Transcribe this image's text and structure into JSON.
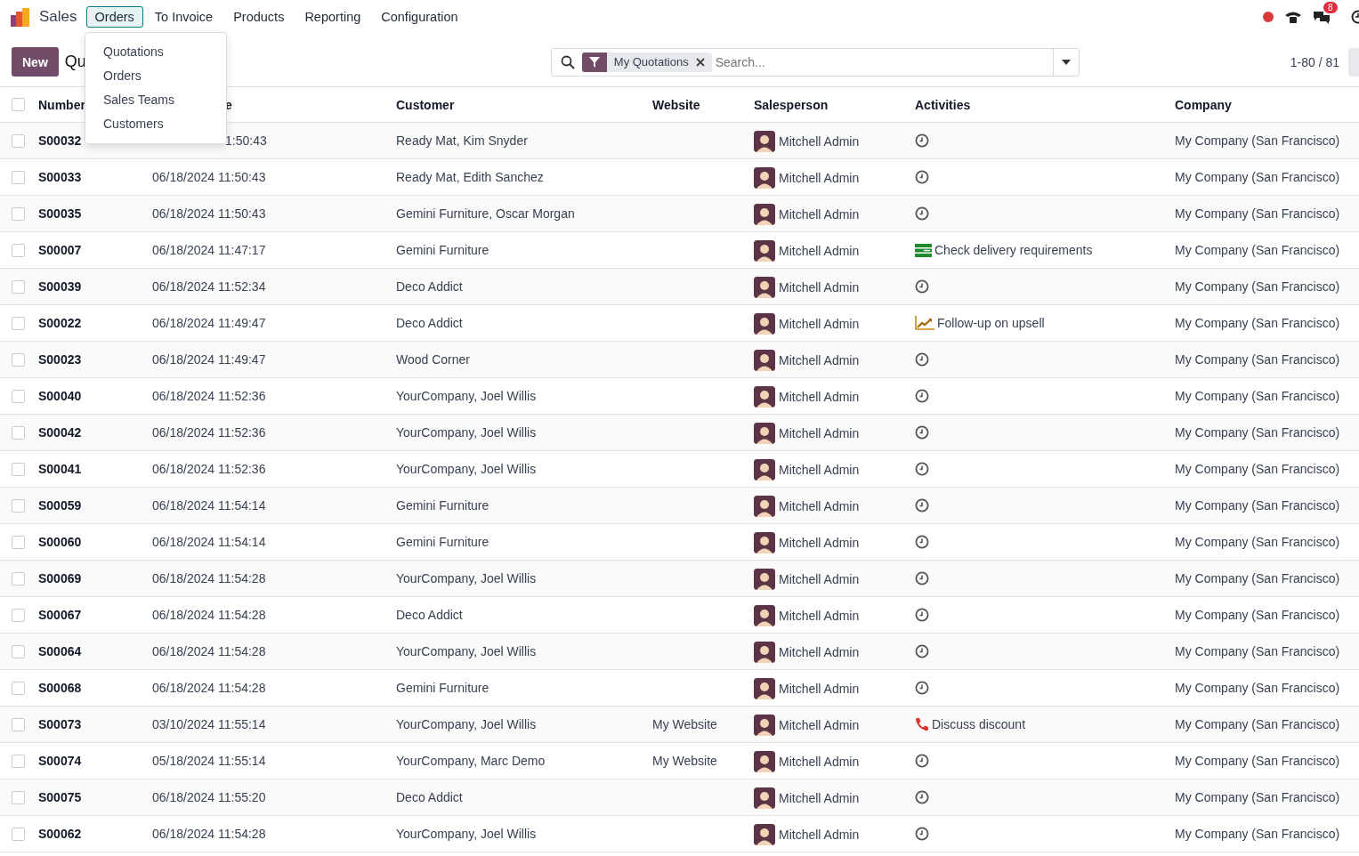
{
  "app": {
    "name": "Sales"
  },
  "menu": [
    {
      "label": "Orders",
      "selected": true
    },
    {
      "label": "To Invoice",
      "selected": false
    },
    {
      "label": "Products",
      "selected": false
    },
    {
      "label": "Reporting",
      "selected": false
    },
    {
      "label": "Configuration",
      "selected": false
    }
  ],
  "systray": {
    "messages_badge": "8"
  },
  "dropdown": {
    "open": true,
    "items": [
      "Quotations",
      "Orders",
      "Sales Teams",
      "Customers"
    ]
  },
  "control_panel": {
    "new_button": "New",
    "title": "Qu",
    "facet": "My Quotations",
    "placeholder": "Search...",
    "pager": "1-80 / 81"
  },
  "table": {
    "select_all_checked": false,
    "columns": [
      "Number",
      "e",
      "Customer",
      "Website",
      "Salesperson",
      "Activities",
      "Company"
    ],
    "rows": [
      {
        "checked": false,
        "number": "S00032",
        "date": "1:50:43",
        "customer": "Ready Mat, Kim Snyder",
        "salesperson": "Mitchell Admin",
        "activity": {
          "kind": "none"
        },
        "company": "My Company (San Francisco)"
      },
      {
        "checked": false,
        "number": "S00033",
        "date": "06/18/2024 11:50:43",
        "customer": "Ready Mat, Edith Sanchez",
        "salesperson": "Mitchell Admin",
        "activity": {
          "kind": "none"
        },
        "company": "My Company (San Francisco)"
      },
      {
        "checked": false,
        "number": "S00035",
        "date": "06/18/2024 11:50:43",
        "customer": "Gemini Furniture, Oscar Morgan",
        "salesperson": "Mitchell Admin",
        "activity": {
          "kind": "none"
        },
        "company": "My Company (San Francisco)"
      },
      {
        "checked": false,
        "number": "S00007",
        "date": "06/18/2024 11:47:17",
        "customer": "Gemini Furniture",
        "salesperson": "Mitchell Admin",
        "activity": {
          "kind": "todo",
          "text": "Check delivery requirements"
        },
        "company": "My Company (San Francisco)"
      },
      {
        "checked": false,
        "number": "S00039",
        "date": "06/18/2024 11:52:34",
        "customer": "Deco Addict",
        "salesperson": "Mitchell Admin",
        "activity": {
          "kind": "none"
        },
        "company": "My Company (San Francisco)"
      },
      {
        "checked": false,
        "number": "S00022",
        "date": "06/18/2024 11:49:47",
        "customer": "Deco Addict",
        "salesperson": "Mitchell Admin",
        "activity": {
          "kind": "upsell",
          "text": "Follow-up on upsell"
        },
        "company": "My Company (San Francisco)"
      },
      {
        "checked": false,
        "number": "S00023",
        "date": "06/18/2024 11:49:47",
        "customer": "Wood Corner",
        "salesperson": "Mitchell Admin",
        "activity": {
          "kind": "none"
        },
        "company": "My Company (San Francisco)"
      },
      {
        "checked": false,
        "number": "S00040",
        "date": "06/18/2024 11:52:36",
        "customer": "YourCompany, Joel Willis",
        "salesperson": "Mitchell Admin",
        "activity": {
          "kind": "none"
        },
        "company": "My Company (San Francisco)"
      },
      {
        "checked": false,
        "number": "S00042",
        "date": "06/18/2024 11:52:36",
        "customer": "YourCompany, Joel Willis",
        "salesperson": "Mitchell Admin",
        "activity": {
          "kind": "none"
        },
        "company": "My Company (San Francisco)"
      },
      {
        "checked": false,
        "number": "S00041",
        "date": "06/18/2024 11:52:36",
        "customer": "YourCompany, Joel Willis",
        "salesperson": "Mitchell Admin",
        "activity": {
          "kind": "none"
        },
        "company": "My Company (San Francisco)"
      },
      {
        "checked": false,
        "number": "S00059",
        "date": "06/18/2024 11:54:14",
        "customer": "Gemini Furniture",
        "salesperson": "Mitchell Admin",
        "activity": {
          "kind": "none"
        },
        "company": "My Company (San Francisco)"
      },
      {
        "checked": false,
        "number": "S00060",
        "date": "06/18/2024 11:54:14",
        "customer": "Gemini Furniture",
        "salesperson": "Mitchell Admin",
        "activity": {
          "kind": "none"
        },
        "company": "My Company (San Francisco)"
      },
      {
        "checked": false,
        "number": "S00069",
        "date": "06/18/2024 11:54:28",
        "customer": "YourCompany, Joel Willis",
        "salesperson": "Mitchell Admin",
        "activity": {
          "kind": "none"
        },
        "company": "My Company (San Francisco)"
      },
      {
        "checked": false,
        "number": "S00067",
        "date": "06/18/2024 11:54:28",
        "customer": "Deco Addict",
        "salesperson": "Mitchell Admin",
        "activity": {
          "kind": "none"
        },
        "company": "My Company (San Francisco)"
      },
      {
        "checked": false,
        "number": "S00064",
        "date": "06/18/2024 11:54:28",
        "customer": "YourCompany, Joel Willis",
        "salesperson": "Mitchell Admin",
        "activity": {
          "kind": "none"
        },
        "company": "My Company (San Francisco)"
      },
      {
        "checked": false,
        "number": "S00068",
        "date": "06/18/2024 11:54:28",
        "customer": "Gemini Furniture",
        "salesperson": "Mitchell Admin",
        "activity": {
          "kind": "none"
        },
        "company": "My Company (San Francisco)"
      },
      {
        "checked": false,
        "number": "S00073",
        "date": "03/10/2024 11:55:14",
        "customer": "YourCompany, Joel Willis",
        "website": "My Website",
        "salesperson": "Mitchell Admin",
        "activity": {
          "kind": "call",
          "text": "Discuss discount"
        },
        "company": "My Company (San Francisco)"
      },
      {
        "checked": false,
        "number": "S00074",
        "date": "05/18/2024 11:55:14",
        "customer": "YourCompany, Marc Demo",
        "website": "My Website",
        "salesperson": "Mitchell Admin",
        "activity": {
          "kind": "none"
        },
        "company": "My Company (San Francisco)"
      },
      {
        "checked": false,
        "number": "S00075",
        "date": "06/18/2024 11:55:20",
        "customer": "Deco Addict",
        "salesperson": "Mitchell Admin",
        "activity": {
          "kind": "none"
        },
        "company": "My Company (San Francisco)"
      },
      {
        "checked": false,
        "number": "S00062",
        "date": "06/18/2024 11:54:28",
        "customer": "YourCompany, Joel Willis",
        "salesperson": "Mitchell Admin",
        "activity": {
          "kind": "none"
        },
        "company": "My Company (San Francisco)"
      }
    ]
  }
}
